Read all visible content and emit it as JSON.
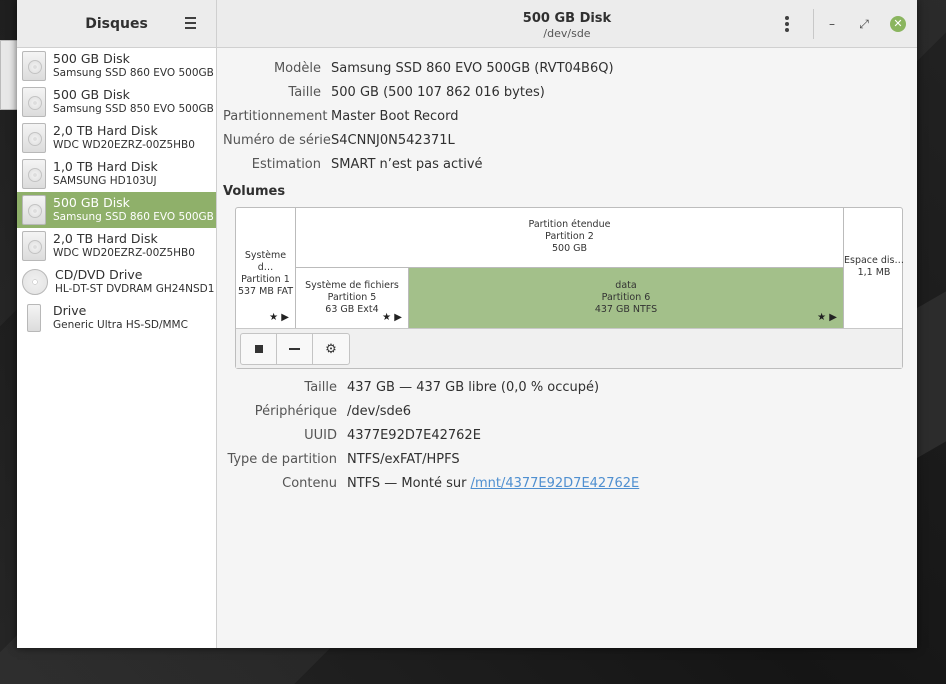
{
  "sidebar": {
    "title": "Disques",
    "devices": [
      {
        "name": "500 GB Disk",
        "sub": "Samsung SSD 860 EVO 500GB",
        "icon": "harddisk-icon"
      },
      {
        "name": "500 GB Disk",
        "sub": "Samsung SSD 850 EVO 500GB",
        "icon": "harddisk-icon"
      },
      {
        "name": "2,0 TB Hard Disk",
        "sub": "WDC WD20EZRZ-00Z5HB0",
        "icon": "harddisk-icon"
      },
      {
        "name": "1,0 TB Hard Disk",
        "sub": "SAMSUNG HD103UJ",
        "icon": "harddisk-icon"
      },
      {
        "name": "500 GB Disk",
        "sub": "Samsung SSD 860 EVO 500GB",
        "icon": "harddisk-icon",
        "selected": true
      },
      {
        "name": "2,0 TB Hard Disk",
        "sub": "WDC WD20EZRZ-00Z5HB0",
        "icon": "harddisk-icon"
      },
      {
        "name": "CD/DVD Drive",
        "sub": "HL-DT-ST DVDRAM GH24NSD1",
        "icon": "optical-drive-icon"
      },
      {
        "name": "Drive",
        "sub": "Generic Ultra HS-SD/MMC",
        "icon": "usb-drive-icon"
      }
    ]
  },
  "header": {
    "title": "500 GB Disk",
    "subtitle": "/dev/sde"
  },
  "disk": {
    "model_label": "Modèle",
    "model": "Samsung SSD 860 EVO 500GB (RVT04B6Q)",
    "size_label": "Taille",
    "size": "500 GB (500 107 862 016 bytes)",
    "partitioning_label": "Partitionnement",
    "partitioning": "Master Boot Record",
    "serial_label": "Numéro de série",
    "serial": "S4CNNJ0N542371L",
    "assessment_label": "Estimation",
    "assessment": "SMART n’est pas activé"
  },
  "volumes": {
    "title": "Volumes",
    "p1": {
      "l1": "Système d…",
      "l2": "Partition 1",
      "l3": "537 MB FAT"
    },
    "ext": {
      "l1": "Partition étendue",
      "l2": "Partition 2",
      "l3": "500 GB"
    },
    "p5": {
      "l1": "Système de fichiers",
      "l2": "Partition 5",
      "l3": "63 GB Ext4"
    },
    "p6": {
      "l1": "data",
      "l2": "Partition 6",
      "l3": "437 GB NTFS"
    },
    "free": {
      "l1": "Espace dis…",
      "l2": "1,1 MB"
    },
    "selected_color": "#a3c08a"
  },
  "details": {
    "size_label": "Taille",
    "size": "437 GB — 437 GB libre (0,0 % occupé)",
    "device_label": "Périphérique",
    "device": "/dev/sde6",
    "uuid_label": "UUID",
    "uuid": "4377E92D7E42762E",
    "ptype_label": "Type de partition",
    "ptype": "NTFS/exFAT/HPFS",
    "contents_label": "Contenu",
    "contents_prefix": "NTFS — Monté sur ",
    "contents_link": "/mnt/4377E92D7E42762E"
  },
  "colors": {
    "accent": "#8fb06a",
    "link": "#4f8fd0"
  }
}
